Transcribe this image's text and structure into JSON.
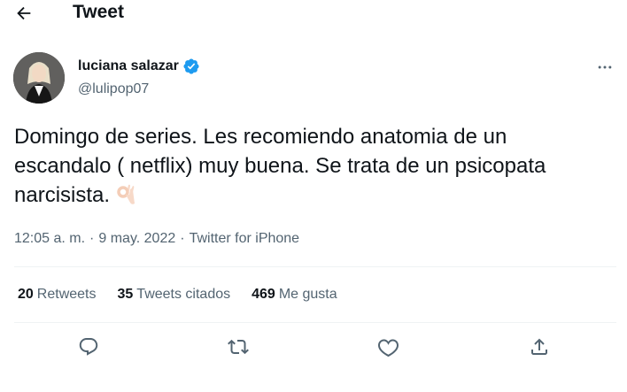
{
  "header": {
    "title": "Tweet",
    "back_icon": "arrow-left-icon"
  },
  "author": {
    "display_name": "luciana salazar",
    "handle": "@lulipop07",
    "verified": true,
    "verified_color": "#1d9bf0"
  },
  "tweet": {
    "text": "Domingo de series. Les recomiendo anatomia de un escandalo ( netflix) muy buena. Se trata de un psicopata narcisista.",
    "emoji": "ok-hand-emoji",
    "time": "12:05 a. m.",
    "separator": "·",
    "date": "9 may. 2022",
    "source": "Twitter for iPhone"
  },
  "stats": [
    {
      "count": "20",
      "label": "Retweets"
    },
    {
      "count": "35",
      "label": "Tweets citados"
    },
    {
      "count": "469",
      "label": "Me gusta"
    }
  ],
  "actions": [
    {
      "icon": "reply-icon"
    },
    {
      "icon": "retweet-icon"
    },
    {
      "icon": "like-heart-icon"
    },
    {
      "icon": "share-icon"
    }
  ],
  "colors": {
    "text": "#0f1419",
    "secondary": "#536471",
    "divider": "#eff3f4",
    "accent": "#1d9bf0"
  }
}
